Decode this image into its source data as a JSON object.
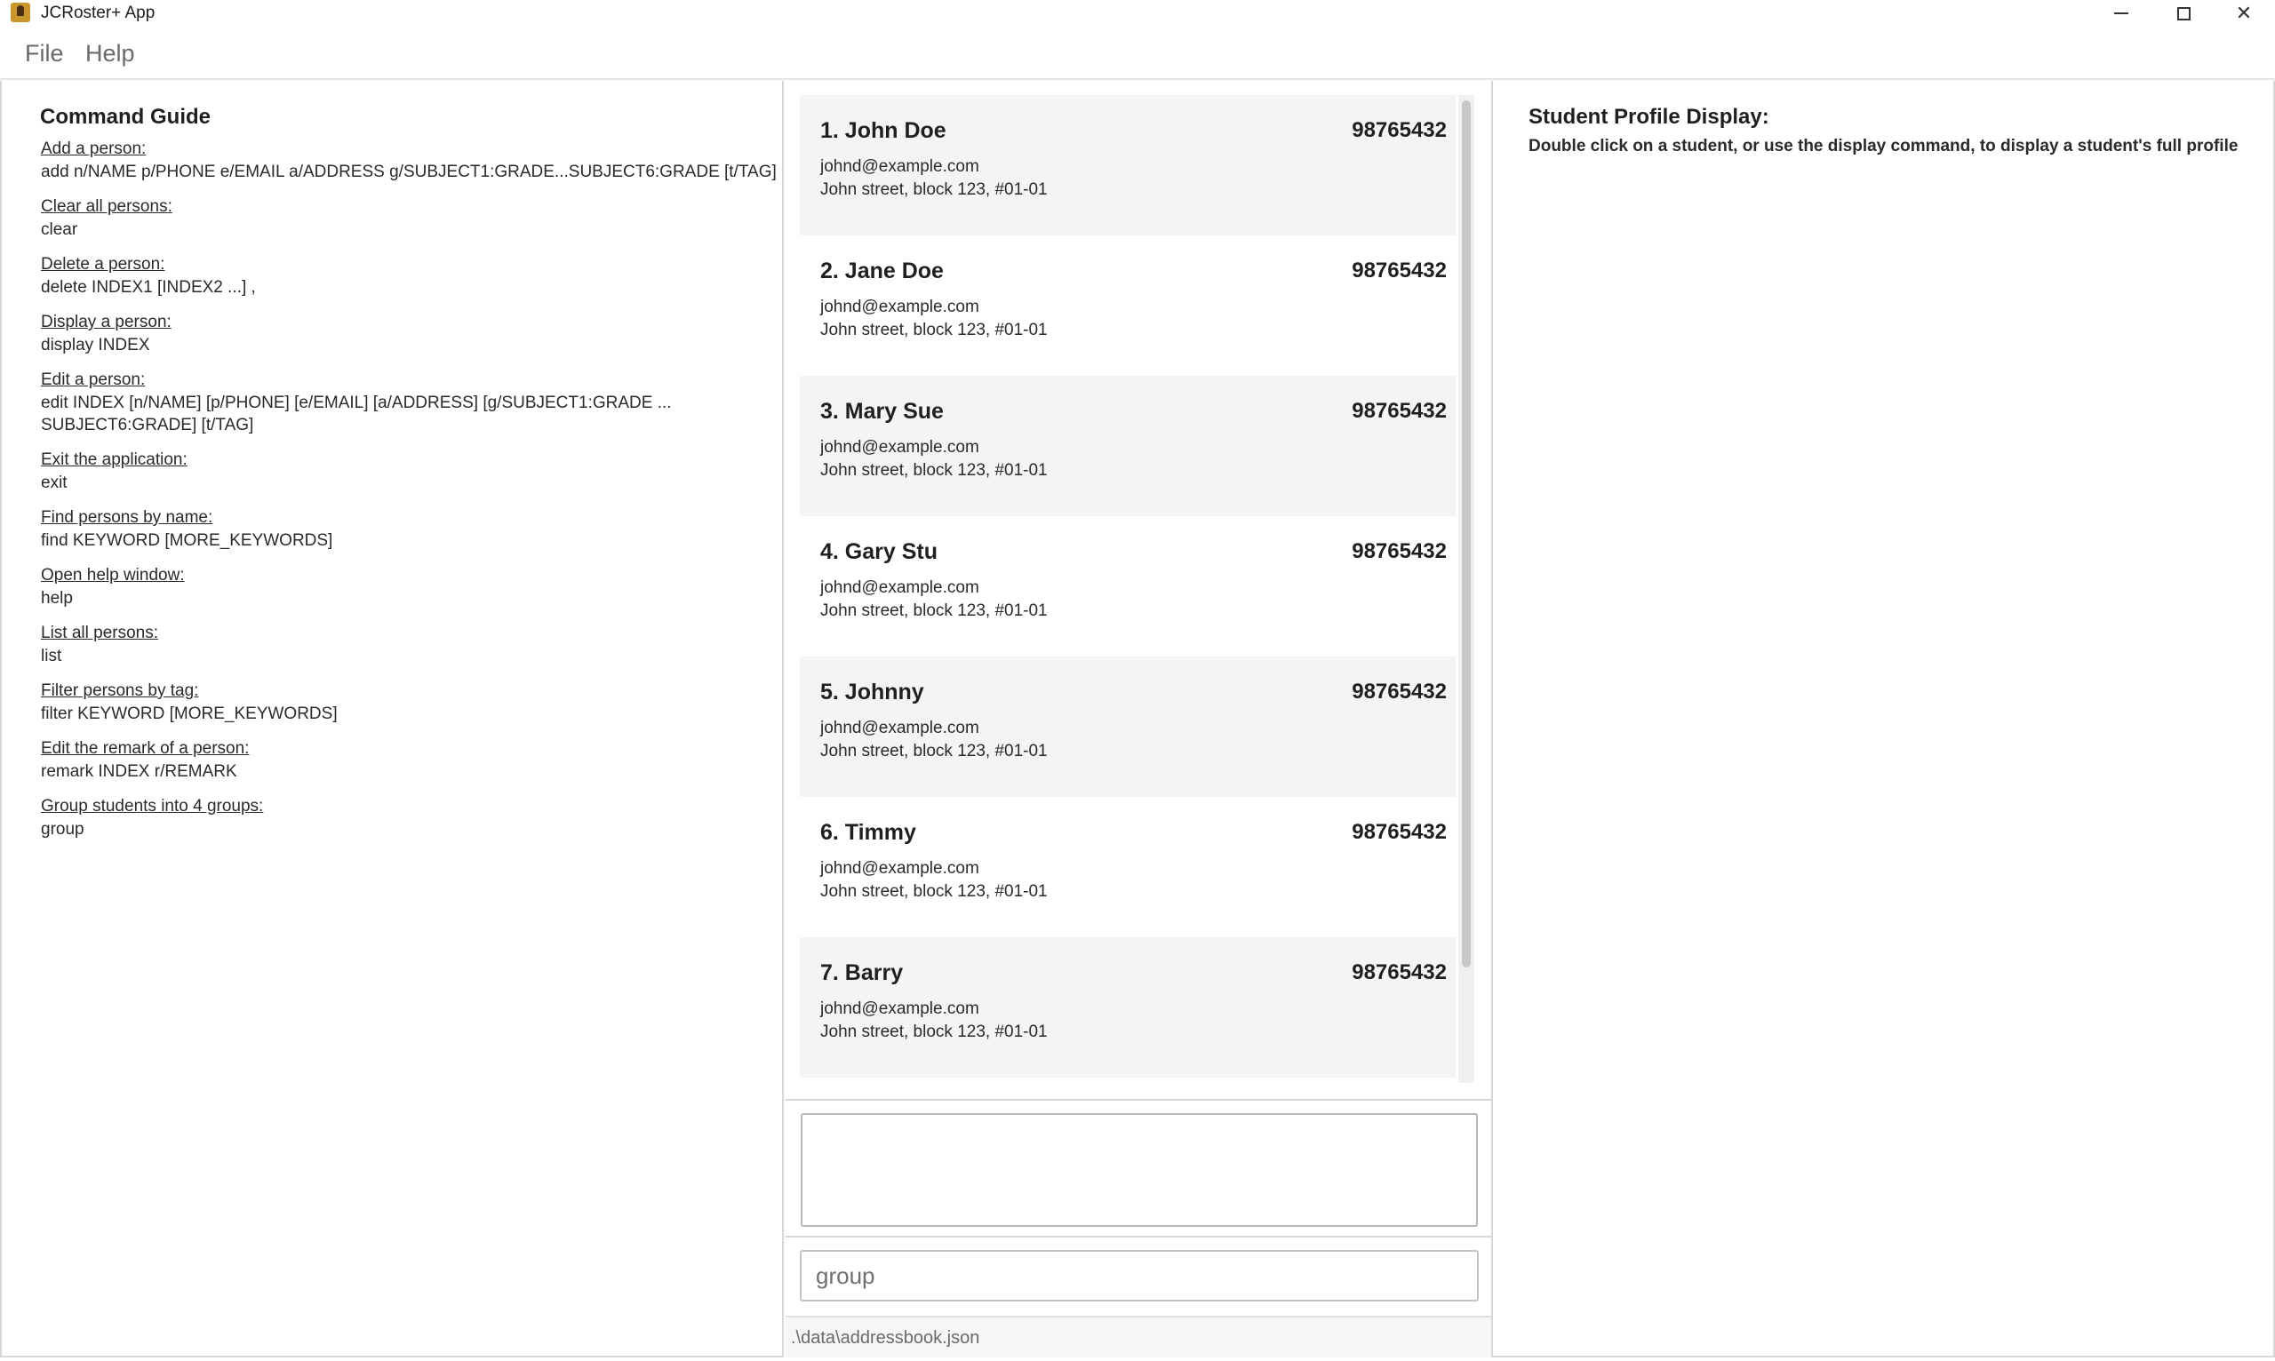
{
  "window": {
    "title": "JCRoster+ App",
    "minimize_glyph": "",
    "close_glyph": "✕"
  },
  "menu": {
    "file": "File",
    "help": "Help"
  },
  "guide": {
    "title": "Command Guide",
    "entries": [
      {
        "desc": "Add a person:",
        "usage": "add n/NAME p/PHONE e/EMAIL a/ADDRESS g/SUBJECT1:GRADE...SUBJECT6:GRADE [t/TAG]"
      },
      {
        "desc": "Clear all persons:",
        "usage": "clear"
      },
      {
        "desc": "Delete a person:",
        "usage": "delete INDEX1 [INDEX2 ...] ,"
      },
      {
        "desc": "Display a person:",
        "usage": "display INDEX"
      },
      {
        "desc": "Edit a person:",
        "usage": "edit INDEX [n/NAME] [p/PHONE] [e/EMAIL] [a/ADDRESS] [g/SUBJECT1:GRADE ... SUBJECT6:GRADE] [t/TAG]"
      },
      {
        "desc": "Exit the application:",
        "usage": "exit"
      },
      {
        "desc": "Find persons by name:",
        "usage": "find KEYWORD [MORE_KEYWORDS]"
      },
      {
        "desc": "Open help window:",
        "usage": "help"
      },
      {
        "desc": "List all persons:",
        "usage": "list"
      },
      {
        "desc": "Filter persons by tag:",
        "usage": "filter KEYWORD [MORE_KEYWORDS]"
      },
      {
        "desc": "Edit the remark of a person:",
        "usage": "remark INDEX r/REMARK"
      },
      {
        "desc": "Group students into 4 groups:",
        "usage": "group"
      }
    ]
  },
  "persons": [
    {
      "name": "1. John Doe",
      "phone": "98765432",
      "email": "johnd@example.com",
      "address": "John street, block 123, #01-01"
    },
    {
      "name": "2. Jane Doe",
      "phone": "98765432",
      "email": "johnd@example.com",
      "address": "John street, block 123, #01-01"
    },
    {
      "name": "3. Mary Sue",
      "phone": "98765432",
      "email": "johnd@example.com",
      "address": "John street, block 123, #01-01"
    },
    {
      "name": "4. Gary Stu",
      "phone": "98765432",
      "email": "johnd@example.com",
      "address": "John street, block 123, #01-01"
    },
    {
      "name": "5. Johnny",
      "phone": "98765432",
      "email": "johnd@example.com",
      "address": "John street, block 123, #01-01"
    },
    {
      "name": "6. Timmy",
      "phone": "98765432",
      "email": "johnd@example.com",
      "address": "John street, block 123, #01-01"
    },
    {
      "name": "7. Barry",
      "phone": "98765432",
      "email": "johnd@example.com",
      "address": "John street, block 123, #01-01"
    }
  ],
  "result_display": {
    "text": ""
  },
  "command_box": {
    "value": "group"
  },
  "status_bar": {
    "save_location": ".\\data\\addressbook.json"
  },
  "profile": {
    "title": "Student Profile Display:",
    "hint": "Double click on a student, or use the display command, to display a student's full profile"
  }
}
